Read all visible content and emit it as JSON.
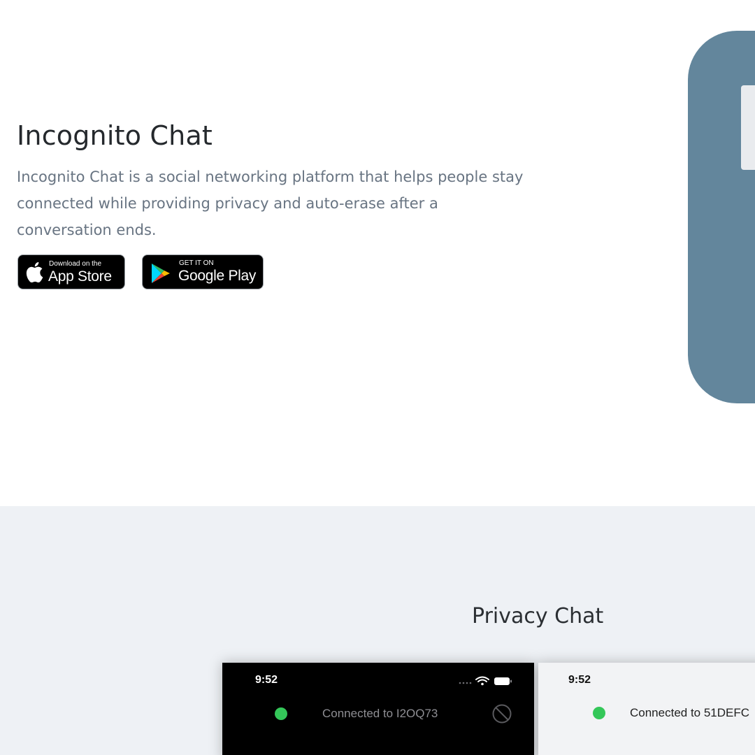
{
  "hero": {
    "title": "Incognito Chat",
    "description": "Incognito Chat is a social networking platform that helps people stay connected while providing privacy and auto-erase after a conversation ends.",
    "app_store_badge": {
      "small": "Download on the",
      "big": "App Store",
      "icon": "apple-icon"
    },
    "google_play_badge": {
      "small": "GET IT ON",
      "big": "Google Play",
      "icon": "google-play-icon"
    }
  },
  "privacy": {
    "title": "Privacy Chat",
    "screens": [
      {
        "theme": "dark",
        "time": "9:52",
        "status": "Connected to I2OQ73",
        "status_color": "#34c759",
        "icons": [
          "signal-dots-icon",
          "wifi-icon",
          "battery-icon",
          "block-icon"
        ]
      },
      {
        "theme": "light",
        "time": "9:52",
        "status": "Connected to 51DEFC",
        "status_color": "#34c759"
      }
    ]
  },
  "colors": {
    "phone_frame": "#63869c",
    "section_background": "#eef1f5",
    "title_text": "#25292d",
    "body_text": "#687482"
  }
}
